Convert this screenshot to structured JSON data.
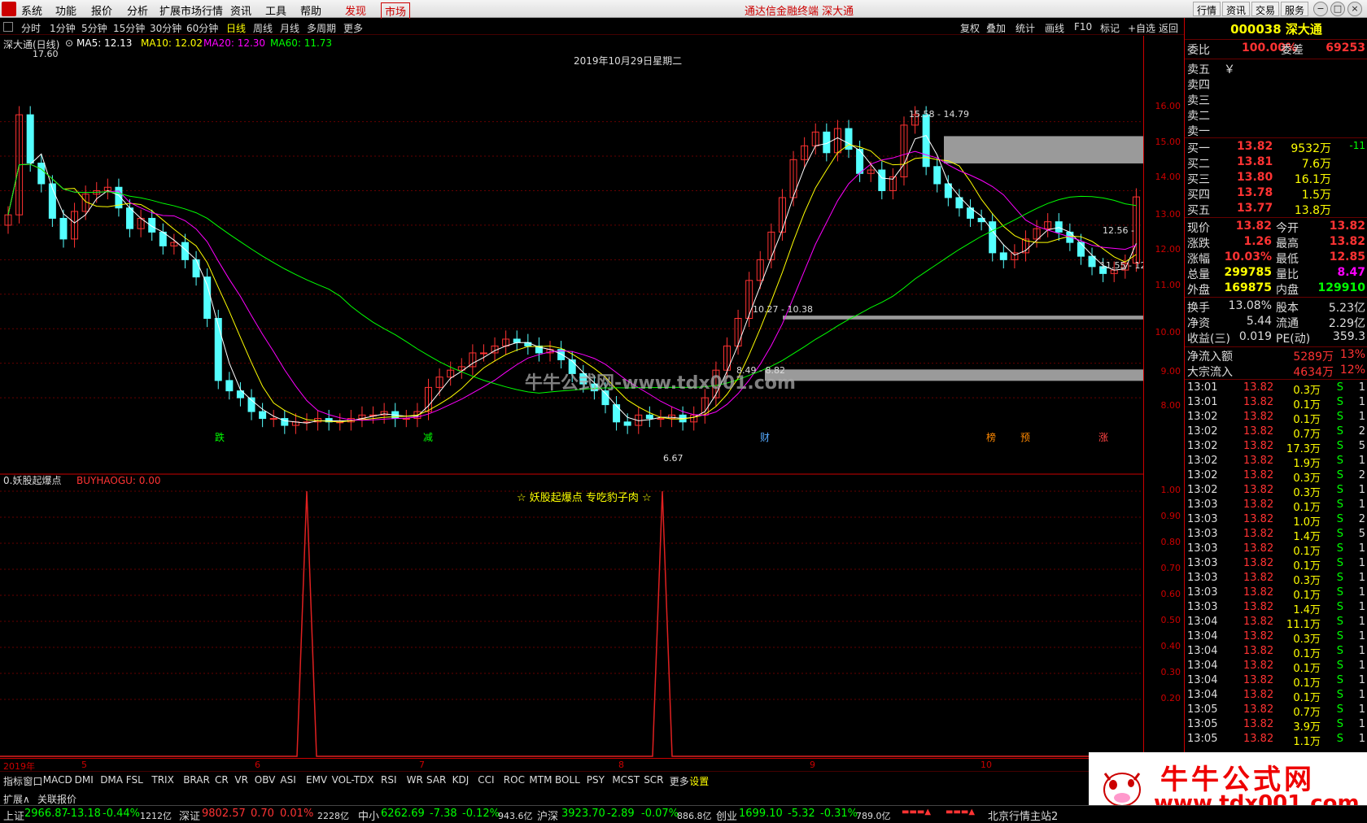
{
  "menu": {
    "items": [
      "系统",
      "功能",
      "报价",
      "分析",
      "扩展市场行情",
      "资讯",
      "工具",
      "帮助"
    ],
    "discover": "发现",
    "market": "市场",
    "title": "通达信金融终端  深大通",
    "right": [
      "行情",
      "资讯",
      "交易",
      "服务"
    ]
  },
  "period": {
    "items": [
      "分时",
      "1分钟",
      "5分钟",
      "15分钟",
      "30分钟",
      "60分钟",
      "日线",
      "周线",
      "月线",
      "多周期",
      "更多"
    ],
    "selected": "日线",
    "tools": [
      "复权",
      "叠加",
      "统计",
      "画线",
      "F10",
      "标记",
      "+自选",
      "返回"
    ]
  },
  "main": {
    "name": "深大通(日线)",
    "ma5": "MA5: 12.13",
    "ma10": "MA10: 12.02",
    "ma20": "MA20: 12.30",
    "ma60": "MA60: 11.73",
    "date_label": "2019年10月29日星期二",
    "high_label": "17.60",
    "low_label": "6.67",
    "zones": [
      "15.58 - 14.79",
      "12.56 -",
      "11.55 - 12",
      "10.27 - 10.38",
      "8.49 - 8.82"
    ],
    "markers": [
      "跌",
      "减",
      "财",
      "榜",
      "预",
      "涨"
    ],
    "axis": [
      "16.00",
      "15.00",
      "14.00",
      "13.00",
      "12.00",
      "11.00",
      "10.00",
      "9.00",
      "8.00"
    ],
    "watermark": "牛牛公式网-www.tdx001.com",
    "colors": {
      "ma5": "#ffffff",
      "ma10": "#ffff00",
      "ma20": "#ff00ff",
      "ma60": "#00ff00",
      "up": "#ff3232",
      "down": "#54ffff"
    }
  },
  "indicator": {
    "name": "0.妖股起爆点",
    "value": "BUYHAOGU: 0.00",
    "caption": "☆ 妖股起爆点 专吃豹子肉 ☆",
    "axis": [
      "1.00",
      "0.90",
      "0.80",
      "0.70",
      "0.60",
      "0.50",
      "0.40",
      "0.30",
      "0.20"
    ]
  },
  "dates": [
    "2019年",
    "5",
    "6",
    "7",
    "8",
    "9",
    "10"
  ],
  "quote": {
    "code": "000038",
    "name": "深大通",
    "wb_label": "委比",
    "wb": "100.00%",
    "wc_label": "委差",
    "wc": "69253",
    "sells": [
      {
        "l": "卖五",
        "p": "￥",
        "v": ""
      },
      {
        "l": "卖四",
        "p": "",
        "v": ""
      },
      {
        "l": "卖三",
        "p": "",
        "v": ""
      },
      {
        "l": "卖二",
        "p": "",
        "v": ""
      },
      {
        "l": "卖一",
        "p": "",
        "v": ""
      }
    ],
    "buys": [
      {
        "l": "买一",
        "p": "13.82",
        "v": "9532万",
        "c": "-11"
      },
      {
        "l": "买二",
        "p": "13.81",
        "v": "7.6万",
        "c": ""
      },
      {
        "l": "买三",
        "p": "13.80",
        "v": "16.1万",
        "c": ""
      },
      {
        "l": "买四",
        "p": "13.78",
        "v": "1.5万",
        "c": ""
      },
      {
        "l": "买五",
        "p": "13.77",
        "v": "13.8万",
        "c": ""
      }
    ],
    "stats": [
      [
        "现价",
        "13.82",
        "今开",
        "13.82"
      ],
      [
        "涨跌",
        "1.26",
        "最高",
        "13.82"
      ],
      [
        "涨幅",
        "10.03%",
        "最低",
        "12.85"
      ],
      [
        "总量",
        "299785",
        "量比",
        "8.47"
      ],
      [
        "外盘",
        "169875",
        "内盘",
        "129910"
      ]
    ],
    "stats2": [
      [
        "换手",
        "13.08%",
        "股本",
        "5.23亿"
      ],
      [
        "净资",
        "5.44",
        "流通",
        "2.29亿"
      ],
      [
        "收益(三)",
        "0.019",
        "PE(动)",
        "359.3"
      ]
    ],
    "flows": [
      [
        "净流入额",
        "5289万",
        "13%"
      ],
      [
        "大宗流入",
        "4634万",
        "12%"
      ]
    ],
    "ticks": [
      [
        "13:01",
        "13.82",
        "0.3万",
        "S",
        "1"
      ],
      [
        "13:01",
        "13.82",
        "0.1万",
        "S",
        "1"
      ],
      [
        "13:02",
        "13.82",
        "0.1万",
        "S",
        "1"
      ],
      [
        "13:02",
        "13.82",
        "0.7万",
        "S",
        "2"
      ],
      [
        "13:02",
        "13.82",
        "17.3万",
        "S",
        "5"
      ],
      [
        "13:02",
        "13.82",
        "1.9万",
        "S",
        "1"
      ],
      [
        "13:02",
        "13.82",
        "0.3万",
        "S",
        "2"
      ],
      [
        "13:02",
        "13.82",
        "0.3万",
        "S",
        "1"
      ],
      [
        "13:03",
        "13.82",
        "0.1万",
        "S",
        "1"
      ],
      [
        "13:03",
        "13.82",
        "1.0万",
        "S",
        "2"
      ],
      [
        "13:03",
        "13.82",
        "1.4万",
        "S",
        "5"
      ],
      [
        "13:03",
        "13.82",
        "0.1万",
        "S",
        "1"
      ],
      [
        "13:03",
        "13.82",
        "0.1万",
        "S",
        "1"
      ],
      [
        "13:03",
        "13.82",
        "0.3万",
        "S",
        "1"
      ],
      [
        "13:03",
        "13.82",
        "0.1万",
        "S",
        "1"
      ],
      [
        "13:03",
        "13.82",
        "1.4万",
        "S",
        "1"
      ],
      [
        "13:04",
        "13.82",
        "11.1万",
        "S",
        "1"
      ],
      [
        "13:04",
        "13.82",
        "0.3万",
        "S",
        "1"
      ],
      [
        "13:04",
        "13.82",
        "0.1万",
        "S",
        "1"
      ],
      [
        "13:04",
        "13.82",
        "0.1万",
        "S",
        "1"
      ],
      [
        "13:04",
        "13.82",
        "0.1万",
        "S",
        "1"
      ],
      [
        "13:04",
        "13.82",
        "0.1万",
        "S",
        "1"
      ],
      [
        "13:05",
        "13.82",
        "0.7万",
        "S",
        "1"
      ],
      [
        "13:05",
        "13.82",
        "3.9万",
        "S",
        "1"
      ],
      [
        "13:05",
        "13.82",
        "1.1万",
        "S",
        "1"
      ]
    ]
  },
  "tabs": [
    "指标",
    "窗口",
    "MACD",
    "DMI",
    "DMA",
    "FSL",
    "TRIX",
    "BRAR",
    "CR",
    "VR",
    "OBV",
    "ASI",
    "EMV",
    "VOL-TDX",
    "RSI",
    "WR",
    "SAR",
    "KDJ",
    "CCI",
    "ROC",
    "MTM",
    "BOLL",
    "PSY",
    "MCST",
    "SCR",
    "更多",
    "设置"
  ],
  "ext": [
    "扩展∧",
    "关联报价"
  ],
  "status": {
    "sh": [
      "上证",
      "2966.87",
      "-13.18",
      "-0.44%",
      "1212亿"
    ],
    "sz": [
      "深证",
      "9802.57",
      "0.70",
      "0.01%",
      "2228亿"
    ],
    "zx": [
      "中小",
      "6262.69",
      "-7.38",
      "-0.12%",
      "943.6亿"
    ],
    "hs": [
      "沪深",
      "3923.70",
      "-2.89",
      "-0.07%",
      "886.8亿"
    ],
    "cy": [
      "创业",
      "1699.10",
      "-5.32",
      "-0.31%",
      "789.0亿"
    ],
    "station": "北京行情主站2"
  },
  "logo": {
    "title": "牛牛公式网",
    "url": "www.tdx001.com"
  },
  "chart_data": {
    "type": "candlestick",
    "close": [
      13.3,
      16.2,
      14.8,
      14.2,
      13.2,
      12.6,
      13.4,
      13.9,
      14.0,
      14.1,
      13.5,
      12.9,
      13.2,
      12.8,
      12.4,
      12.5,
      12.0,
      11.5,
      10.3,
      8.5,
      8.2,
      8.0,
      7.6,
      7.4,
      7.4,
      7.2,
      7.3,
      7.3,
      7.4,
      7.3,
      7.3,
      7.4,
      7.5,
      7.5,
      7.6,
      7.4,
      7.4,
      7.6,
      8.3,
      8.6,
      8.8,
      8.9,
      9.3,
      9.3,
      9.5,
      9.7,
      9.6,
      9.5,
      9.3,
      9.4,
      9.1,
      8.7,
      8.4,
      8.2,
      7.8,
      7.3,
      7.2,
      7.5,
      7.4,
      7.4,
      7.5,
      7.3,
      7.5,
      8.0,
      8.8,
      9.5,
      10.3,
      11.4,
      12.0,
      12.8,
      13.8,
      14.9,
      15.3,
      15.7,
      15.1,
      15.8,
      15.2,
      14.5,
      14.6,
      14.0,
      14.4,
      15.9,
      16.2,
      14.7,
      14.2,
      13.8,
      13.5,
      13.2,
      13.1,
      12.2,
      12.0,
      12.2,
      12.6,
      12.9,
      13.1,
      12.8,
      12.5,
      12.1,
      11.8,
      11.6,
      11.7,
      11.9,
      13.82
    ]
  }
}
